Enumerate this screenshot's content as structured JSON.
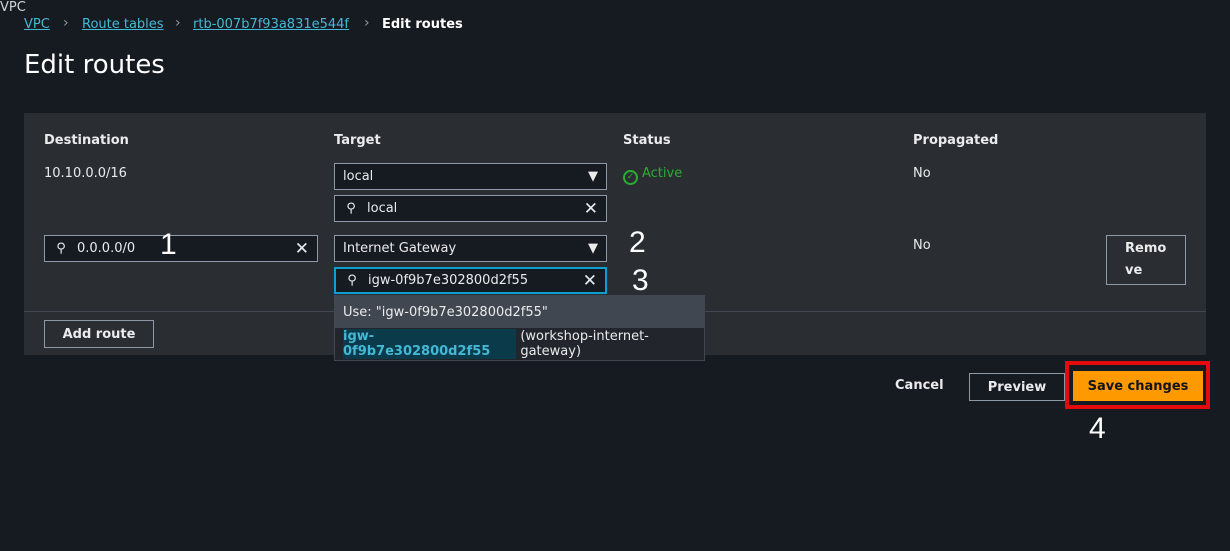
{
  "breadcrumb": [
    "VPC",
    "Route tables",
    "rtb-007b7f93a831e544f",
    "Edit routes"
  ],
  "page_title": "Edit routes",
  "table": {
    "headers": [
      "Destination",
      "Target",
      "Status",
      "Propagated"
    ],
    "rows": [
      {
        "destination": "10.10.0.0/16",
        "target_select": "local",
        "target_search": "local",
        "status": "Active",
        "propagated": "No"
      },
      {
        "destination": "0.0.0.0/0",
        "target_select": "Internet Gateway",
        "target_search": "igw-0f9b7e302800d2f55",
        "propagated": "No",
        "remove_label": "Remo ve"
      }
    ]
  },
  "dropdown": {
    "use_option": "Use: \"igw-0f9b7e302800d2f55\"",
    "match": "igw-0f9b7e302800d2f55",
    "match_name": "(workshop-internet-gateway)"
  },
  "add_route": "Add route",
  "actions": {
    "cancel": "Cancel",
    "preview": "Preview",
    "save": "Save changes"
  },
  "annotations": [
    "1",
    "2",
    "3",
    "4"
  ],
  "colors": {
    "accent": "#ff9900",
    "link": "#44b9d6",
    "active": "#29ad32",
    "highlight": "#e30b0b"
  }
}
